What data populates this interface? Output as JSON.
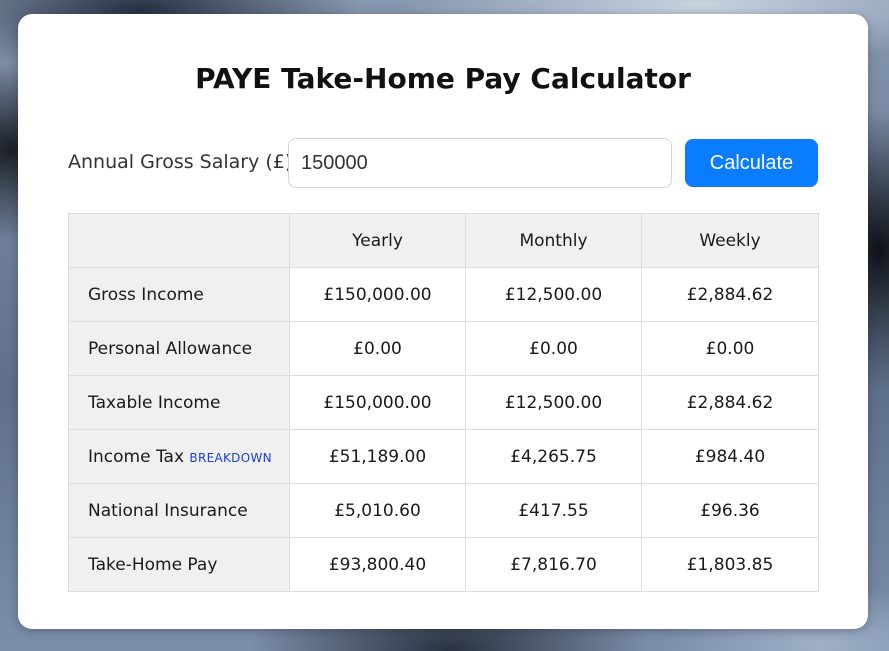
{
  "title": "PAYE Take-Home Pay Calculator",
  "salary": {
    "label": "Annual Gross Salary (£):",
    "value": "150000",
    "button_label": "Calculate"
  },
  "colors": {
    "accent": "#0a7cff",
    "link": "#1a3de0",
    "header_bg": "#f0f0f0"
  },
  "table": {
    "columns": [
      "",
      "Yearly",
      "Monthly",
      "Weekly"
    ],
    "rows": [
      {
        "label": "Gross Income",
        "yearly": "£150,000.00",
        "monthly": "£12,500.00",
        "weekly": "£2,884.62"
      },
      {
        "label": "Personal Allowance",
        "yearly": "£0.00",
        "monthly": "£0.00",
        "weekly": "£0.00"
      },
      {
        "label": "Taxable Income",
        "yearly": "£150,000.00",
        "monthly": "£12,500.00",
        "weekly": "£2,884.62"
      },
      {
        "label": "Income Tax",
        "link": "BREAKDOWN",
        "yearly": "£51,189.00",
        "monthly": "£4,265.75",
        "weekly": "£984.40"
      },
      {
        "label": "National Insurance",
        "yearly": "£5,010.60",
        "monthly": "£417.55",
        "weekly": "£96.36"
      },
      {
        "label": "Take-Home Pay",
        "yearly": "£93,800.40",
        "monthly": "£7,816.70",
        "weekly": "£1,803.85"
      }
    ]
  }
}
